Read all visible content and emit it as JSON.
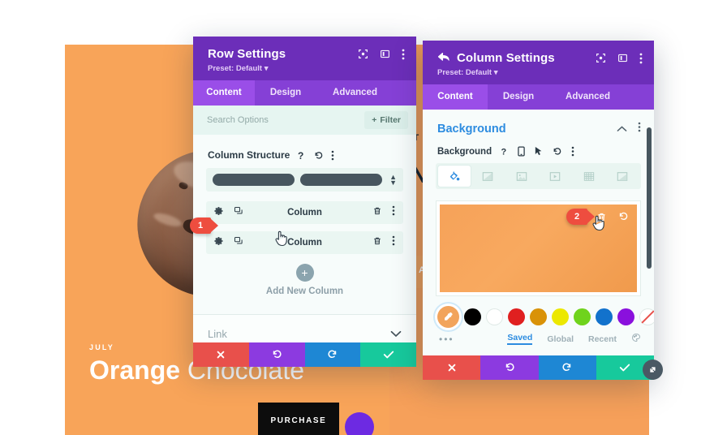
{
  "page": {
    "hero": {
      "kicker": "JULY",
      "title_bold": "Orange",
      "title_light": "Chocolate",
      "purchase_label": "PURCHASE"
    },
    "partial_text": {
      "right_of_row_panel_1": "IT",
      "right_of_row_panel_2": "N",
      "right_of_row_panel_3": ")",
      "right_of_row_panel_4": "A"
    }
  },
  "row_settings": {
    "title": "Row Settings",
    "preset": "Preset: Default",
    "header_icons": [
      "focus-icon",
      "layout-icon",
      "more-vertical-icon"
    ],
    "tabs": [
      {
        "label": "Content",
        "active": true
      },
      {
        "label": "Design",
        "active": false
      },
      {
        "label": "Advanced",
        "active": false
      }
    ],
    "search": {
      "placeholder": "Search Options",
      "value": ""
    },
    "filter_label": "Filter",
    "column_structure": {
      "label": "Column Structure",
      "icons": [
        "help-icon",
        "reset-icon",
        "more-vertical-icon"
      ]
    },
    "columns": [
      {
        "name": "Column"
      },
      {
        "name": "Column"
      }
    ],
    "add_new_column": "Add New Column",
    "link_accordion": "Link",
    "footer": {
      "cancel": "✕",
      "undo": "↺",
      "redo": "↻",
      "save": "✓"
    }
  },
  "column_settings": {
    "title": "Column Settings",
    "preset": "Preset: Default",
    "header_icons": [
      "focus-icon",
      "layout-icon",
      "more-vertical-icon"
    ],
    "tabs": [
      {
        "label": "Content",
        "active": true
      },
      {
        "label": "Design",
        "active": false
      },
      {
        "label": "Advanced",
        "active": false
      }
    ],
    "section": {
      "title": "Background",
      "collapse_icon": "chevron-up-icon",
      "more_icon": "more-vertical-icon"
    },
    "field": {
      "label": "Background",
      "icons": [
        "help-icon",
        "mobile-icon",
        "hover-icon",
        "reset-icon",
        "more-vertical-icon"
      ]
    },
    "background_tabs": [
      {
        "name": "background-color-tab",
        "active": true
      },
      {
        "name": "background-gradient-tab",
        "active": false
      },
      {
        "name": "background-image-tab",
        "active": false
      },
      {
        "name": "background-video-tab",
        "active": false
      },
      {
        "name": "background-pattern-tab",
        "active": false
      },
      {
        "name": "background-mask-tab",
        "active": false
      }
    ],
    "preview": {
      "color": "#f6a259",
      "delete_icon": "trash-icon",
      "reset_icon": "reset-icon"
    },
    "palette": {
      "selected": "#f2a45c",
      "colors": [
        "#000000",
        "#ffffff",
        "#e02020",
        "#d99208",
        "#ece800",
        "#6fd31c",
        "#1272cc",
        "#8a10dd",
        "transparent"
      ]
    },
    "palette_footer": {
      "more": "•••",
      "links": [
        {
          "label": "Saved",
          "active": true
        },
        {
          "label": "Global",
          "active": false
        },
        {
          "label": "Recent",
          "active": false
        }
      ],
      "settings_icon": "palette-settings-icon"
    },
    "footer": {
      "cancel": "✕",
      "undo": "↺",
      "redo": "↻",
      "save": "✓"
    }
  },
  "callouts": [
    {
      "number": "1",
      "target": "row-column-2-gear"
    },
    {
      "number": "2",
      "target": "background-delete-icon"
    }
  ]
}
